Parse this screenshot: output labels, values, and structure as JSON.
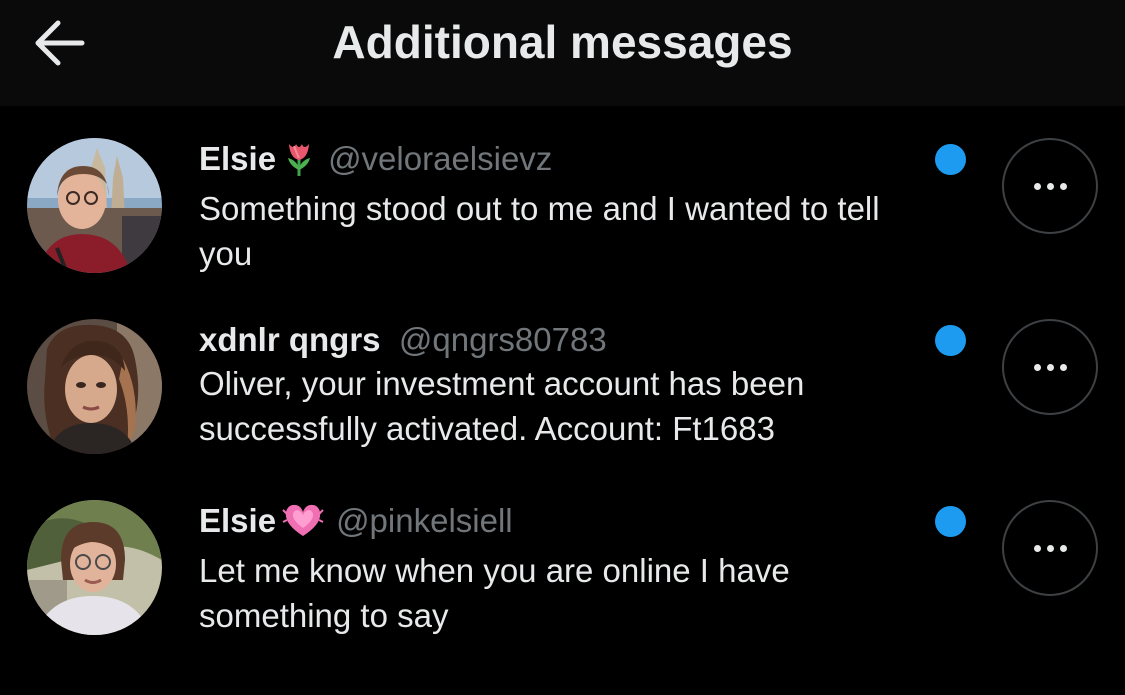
{
  "header": {
    "title": "Additional messages",
    "back_icon": "arrow-left-icon"
  },
  "colors": {
    "background": "#000000",
    "header_background": "#0a0a0a",
    "unread_dot": "#1d9bf0",
    "handle": "#71767b",
    "text": "#e7e9ea"
  },
  "messages": [
    {
      "name": "Elsie",
      "emoji": "tulip-emoji",
      "handle": "@veloraelsievz",
      "text": "Something stood out to me and I wanted to tell you",
      "unread": true
    },
    {
      "name": "xdnlr qngrs",
      "emoji": "",
      "handle": "@qngrs80783",
      "text": "Oliver, your investment account has been successfully activated. Account: Ft1683",
      "unread": true
    },
    {
      "name": "Elsie",
      "emoji": "growing-heart-emoji",
      "handle": "@pinkelsiell",
      "text": "Let me know when you are online I have something to say",
      "unread": true
    }
  ]
}
